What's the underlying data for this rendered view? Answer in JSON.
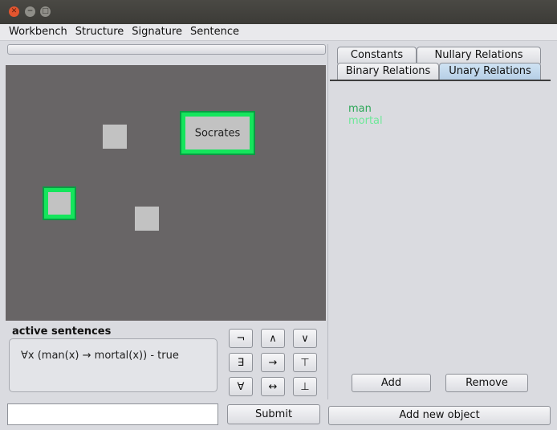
{
  "window": {
    "close_icon": "close-icon",
    "minimize_icon": "minimize-icon",
    "maximize_icon": "maximize-icon"
  },
  "menu": [
    "Workbench",
    "Structure",
    "Signature",
    "Sentence"
  ],
  "canvas": {
    "background": "#686566",
    "objects": [
      {
        "label": "",
        "selected": false
      },
      {
        "label": "Socrates",
        "selected": true
      },
      {
        "label": "",
        "selected": true
      },
      {
        "label": "",
        "selected": false
      }
    ]
  },
  "active_sentences": {
    "title": "active sentences",
    "items": [
      "∀x (man(x) → mortal(x)) - true"
    ]
  },
  "symbols": [
    "¬",
    "∧",
    "∨",
    "∃",
    "→",
    "⊤",
    "∀",
    "↔",
    "⊥"
  ],
  "sentence_input": {
    "value": ""
  },
  "submit_label": "Submit",
  "tabs": {
    "row1": [
      "Constants",
      "Nullary Relations"
    ],
    "row2": [
      "Binary Relations",
      "Unary Relations"
    ],
    "active": "Unary Relations"
  },
  "unary_relations": [
    {
      "name": "man",
      "color": "#2fa85a"
    },
    {
      "name": "mortal",
      "color": "#6fe89a"
    }
  ],
  "add_label": "Add",
  "remove_label": "Remove",
  "add_object_label": "Add new object",
  "colors": {
    "selection": "#15e55c",
    "active_tab": "#c2d9ee"
  }
}
